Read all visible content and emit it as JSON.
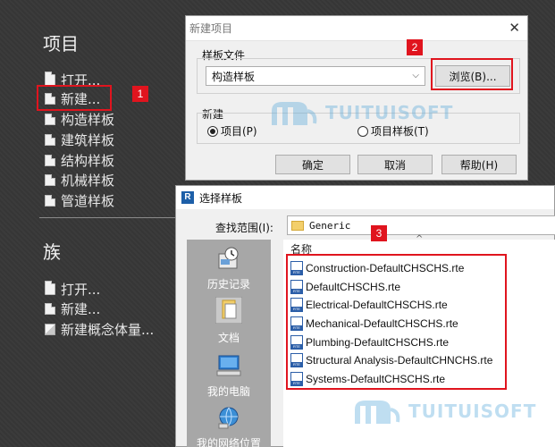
{
  "left": {
    "project_title": "项目",
    "project_items": [
      {
        "label": "打开...",
        "icon": "folder-icon"
      },
      {
        "label": "新建...",
        "icon": "new-document-icon"
      },
      {
        "label": "构造样板",
        "icon": "document-icon"
      },
      {
        "label": "建筑样板",
        "icon": "document-icon"
      },
      {
        "label": "结构样板",
        "icon": "document-icon"
      },
      {
        "label": "机械样板",
        "icon": "document-icon"
      },
      {
        "label": "管道样板",
        "icon": "document-icon"
      }
    ],
    "family_title": "族",
    "family_items": [
      {
        "label": "打开...",
        "icon": "folder-icon"
      },
      {
        "label": "新建...",
        "icon": "new-document-icon"
      },
      {
        "label": "新建概念体量...",
        "icon": "cube-icon"
      }
    ]
  },
  "badges": [
    "1",
    "2",
    "3"
  ],
  "new_project_dialog": {
    "title": "新建项目",
    "close": "✕",
    "template_group_label": "样板文件",
    "template_value": "构造样板",
    "browse_label": "浏览(B)...",
    "new_group_label": "新建",
    "radio_project": "项目(P)",
    "radio_template": "项目样板(T)",
    "ok_label": "确定",
    "cancel_label": "取消",
    "help_label": "帮助(H)"
  },
  "select_template_dialog": {
    "title": "选择样板",
    "app_logo": "R",
    "look_in_label": "查找范围(I):",
    "look_in_value": "Generic",
    "places": [
      "历史记录",
      "文档",
      "我的电脑",
      "我的网络位置"
    ],
    "column_name": "名称",
    "files": [
      "Construction-DefaultCHSCHS.rte",
      "DefaultCHSCHS.rte",
      "Electrical-DefaultCHSCHS.rte",
      "Mechanical-DefaultCHSCHS.rte",
      "Plumbing-DefaultCHSCHS.rte",
      "Structural Analysis-DefaultCHNCHS.rte",
      "Systems-DefaultCHSCHS.rte"
    ]
  },
  "watermark": "TUITUISOFT",
  "colors": {
    "accent_red": "#e0141e",
    "watermark_blue": "#4ba3d8"
  }
}
